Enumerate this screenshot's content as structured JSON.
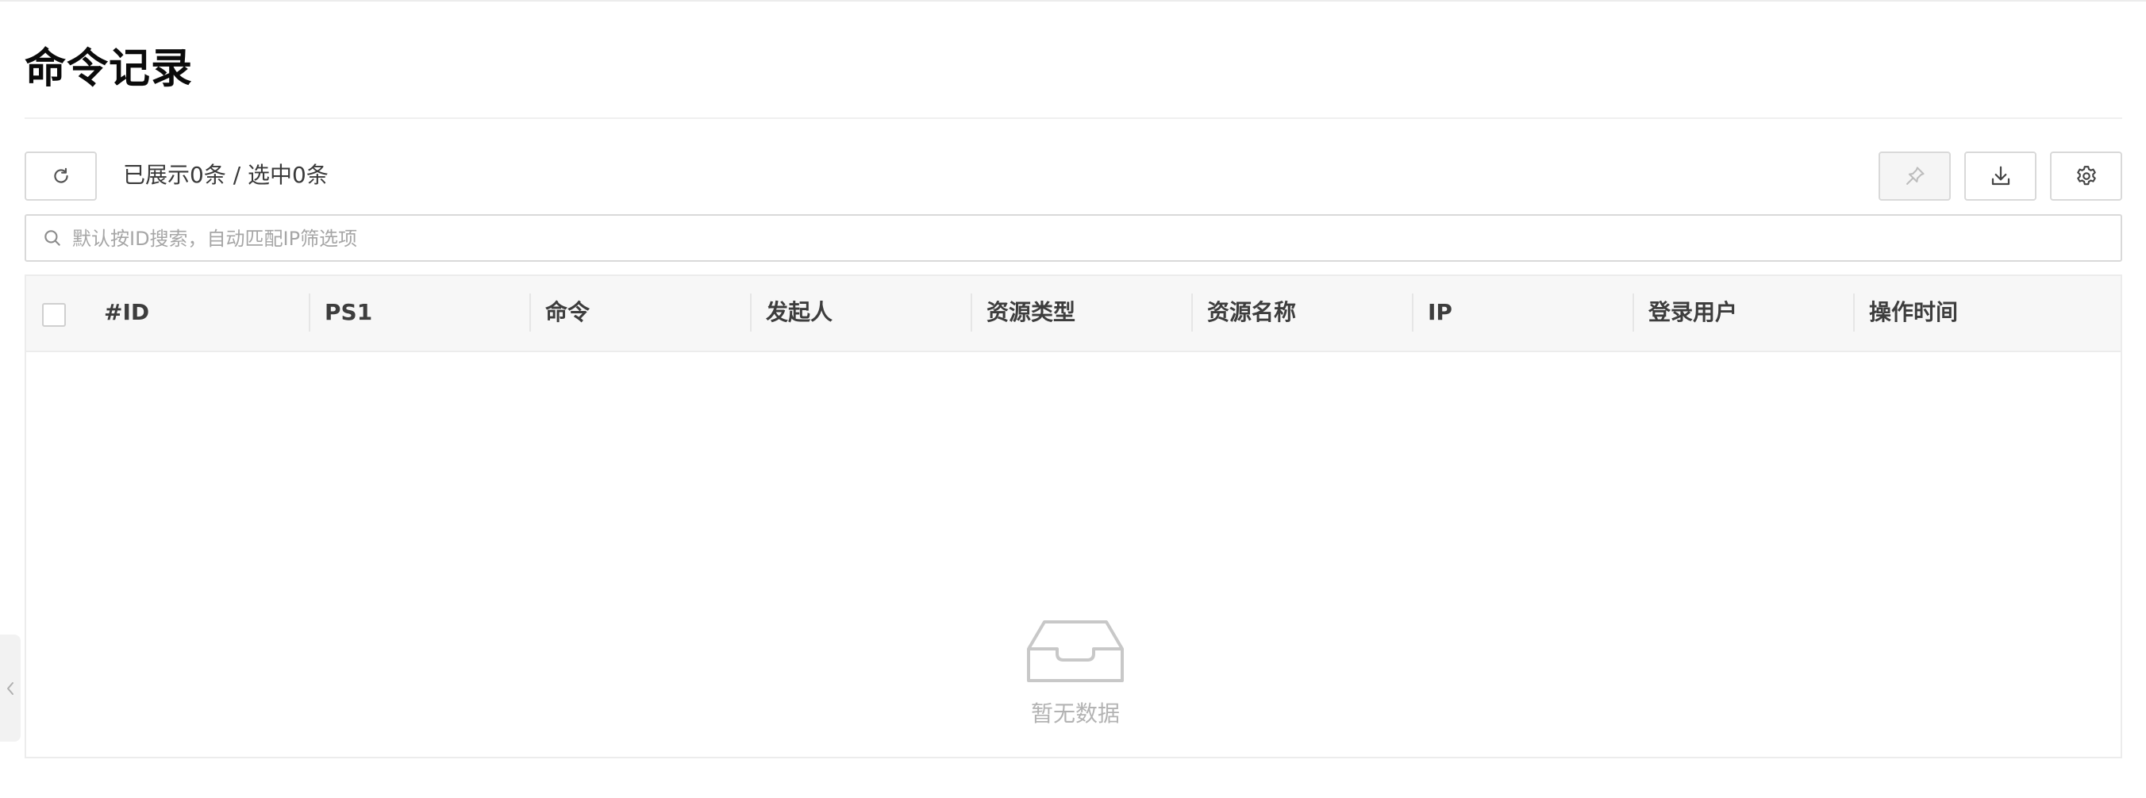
{
  "page": {
    "title": "命令记录"
  },
  "toolbar": {
    "summary": "已展示0条 / 选中0条",
    "refresh_icon": "refresh-icon",
    "pin_icon": "pin-icon",
    "download_icon": "download-icon",
    "settings_icon": "gear-icon"
  },
  "search": {
    "placeholder": "默认按ID搜索，自动匹配IP筛选项",
    "value": ""
  },
  "table": {
    "columns": [
      "#ID",
      "PS1",
      "命令",
      "发起人",
      "资源类型",
      "资源名称",
      "IP",
      "登录用户",
      "操作时间"
    ],
    "rows": [],
    "empty_text": "暂无数据"
  },
  "colors": {
    "border": "#d9d9d9",
    "header_bg": "#f7f7f7",
    "muted_text": "#b3b3b3"
  }
}
